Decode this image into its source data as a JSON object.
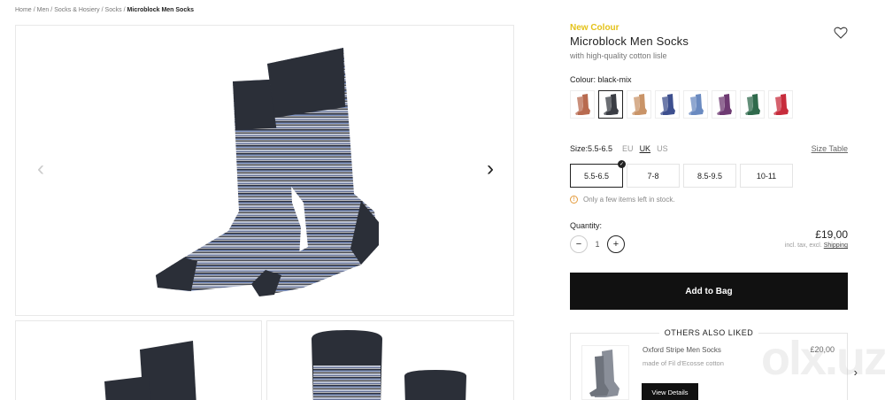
{
  "breadcrumb": {
    "items": [
      "Home",
      "Men",
      "Socks & Hosiery",
      "Socks"
    ],
    "current": "Microblock Men Socks",
    "separator": "/"
  },
  "gallery": {
    "prev_arrow": "‹",
    "next_arrow": "›"
  },
  "product": {
    "badge": "New Colour",
    "title": "Microblock Men Socks",
    "subtitle": "with high-quality cotton lisle",
    "wishlist_icon": "heart-icon"
  },
  "colour": {
    "label": "Colour:",
    "selected": "black-mix",
    "swatches": [
      {
        "name": "rust",
        "color": "#b86a4f"
      },
      {
        "name": "black-mix",
        "color": "#3a3d44"
      },
      {
        "name": "beige",
        "color": "#c99468"
      },
      {
        "name": "navy",
        "color": "#3d4f8e"
      },
      {
        "name": "blue",
        "color": "#6a8ac0"
      },
      {
        "name": "purple",
        "color": "#6e3a72"
      },
      {
        "name": "green",
        "color": "#2f6a4c"
      },
      {
        "name": "red",
        "color": "#c72c3c"
      }
    ]
  },
  "size": {
    "label": "Size:",
    "selected": "5.5-6.5",
    "units": [
      "EU",
      "UK",
      "US"
    ],
    "active_unit": "UK",
    "size_table": "Size Table",
    "options": [
      "5.5-6.5",
      "7-8",
      "8.5-9.5",
      "10-11"
    ]
  },
  "stock": {
    "message": "Only a few items left in stock."
  },
  "quantity": {
    "label": "Quantity:",
    "value": "1",
    "minus": "−",
    "plus": "+"
  },
  "price": {
    "amount": "£19,00",
    "note": "incl. tax, excl.",
    "shipping": "Shipping"
  },
  "cta": {
    "add_to_bag": "Add to Bag"
  },
  "others": {
    "title": "OTHERS ALSO LIKED",
    "item": {
      "name": "Oxford Stripe Men Socks",
      "desc": "made of Fil d'Ecosse cotton",
      "price": "£20,00",
      "button": "View Details"
    },
    "next_arrow": "›"
  },
  "watermark": "olx.uz"
}
